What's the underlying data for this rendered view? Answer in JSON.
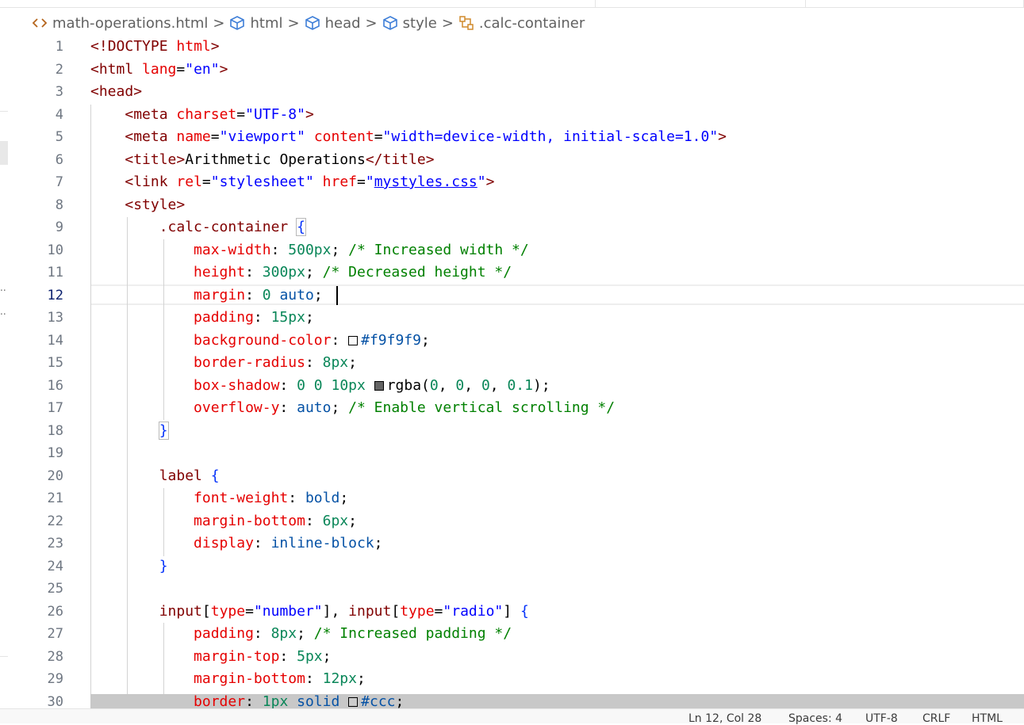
{
  "breadcrumb": [
    {
      "label": "math-operations.html",
      "icon": "html-file-icon"
    },
    {
      "label": "html",
      "icon": "cube-icon"
    },
    {
      "label": "head",
      "icon": "cube-icon"
    },
    {
      "label": "style",
      "icon": "cube-icon"
    },
    {
      "label": ".calc-container",
      "icon": "css-selector-icon"
    }
  ],
  "breadcrumb_separator": ">",
  "status_bar": {
    "position": "Ln 12, Col 28",
    "spaces": "Spaces: 4",
    "encoding": "UTF-8",
    "eol": "CRLF",
    "language": "HTML"
  },
  "edge_marks": [
    "..",
    ".."
  ],
  "editor": {
    "active_line": 12,
    "lines": [
      {
        "n": "1",
        "tokens": [
          [
            "t-punct",
            "<!"
          ],
          [
            "t-tag",
            "DOCTYPE"
          ],
          [
            "t-plain",
            " "
          ],
          [
            "t-attr",
            "html"
          ],
          [
            "t-punct",
            ">"
          ]
        ]
      },
      {
        "n": "2",
        "tokens": [
          [
            "t-punct",
            "<"
          ],
          [
            "t-tag",
            "html"
          ],
          [
            "t-plain",
            " "
          ],
          [
            "t-attr",
            "lang"
          ],
          [
            "t-plain",
            "="
          ],
          [
            "t-str",
            "\"en\""
          ],
          [
            "t-punct",
            ">"
          ]
        ]
      },
      {
        "n": "3",
        "tokens": [
          [
            "t-punct",
            "<"
          ],
          [
            "t-tag",
            "head"
          ],
          [
            "t-punct",
            ">"
          ]
        ]
      },
      {
        "n": "4",
        "tokens": [
          [
            "t-plain",
            "    "
          ],
          [
            "t-punct",
            "<"
          ],
          [
            "t-tag",
            "meta"
          ],
          [
            "t-plain",
            " "
          ],
          [
            "t-attr",
            "charset"
          ],
          [
            "t-plain",
            "="
          ],
          [
            "t-str",
            "\"UTF-8\""
          ],
          [
            "t-punct",
            ">"
          ]
        ]
      },
      {
        "n": "5",
        "tokens": [
          [
            "t-plain",
            "    "
          ],
          [
            "t-punct",
            "<"
          ],
          [
            "t-tag",
            "meta"
          ],
          [
            "t-plain",
            " "
          ],
          [
            "t-attr",
            "name"
          ],
          [
            "t-plain",
            "="
          ],
          [
            "t-str",
            "\"viewport\""
          ],
          [
            "t-plain",
            " "
          ],
          [
            "t-attr",
            "content"
          ],
          [
            "t-plain",
            "="
          ],
          [
            "t-str",
            "\"width=device-width, initial-scale=1.0\""
          ],
          [
            "t-punct",
            ">"
          ]
        ]
      },
      {
        "n": "6",
        "tokens": [
          [
            "t-plain",
            "    "
          ],
          [
            "t-punct",
            "<"
          ],
          [
            "t-tag",
            "title"
          ],
          [
            "t-punct",
            ">"
          ],
          [
            "t-text",
            "Arithmetic Operations"
          ],
          [
            "t-punct",
            "</"
          ],
          [
            "t-tag",
            "title"
          ],
          [
            "t-punct",
            ">"
          ]
        ]
      },
      {
        "n": "7",
        "tokens": [
          [
            "t-plain",
            "    "
          ],
          [
            "t-punct",
            "<"
          ],
          [
            "t-tag",
            "link"
          ],
          [
            "t-plain",
            " "
          ],
          [
            "t-attr",
            "rel"
          ],
          [
            "t-plain",
            "="
          ],
          [
            "t-str",
            "\"stylesheet\""
          ],
          [
            "t-plain",
            " "
          ],
          [
            "t-attr",
            "href"
          ],
          [
            "t-plain",
            "="
          ],
          [
            "t-str",
            "\""
          ],
          [
            "t-link",
            "mystyles.css"
          ],
          [
            "t-str",
            "\""
          ],
          [
            "t-punct",
            ">"
          ]
        ]
      },
      {
        "n": "8",
        "tokens": [
          [
            "t-plain",
            "    "
          ],
          [
            "t-punct",
            "<"
          ],
          [
            "t-tag",
            "style"
          ],
          [
            "t-punct",
            ">"
          ]
        ]
      },
      {
        "n": "9",
        "tokens": [
          [
            "t-plain",
            "        "
          ],
          [
            "t-sel",
            ".calc-container"
          ],
          [
            "t-plain",
            " "
          ],
          [
            "t-brace box",
            "{"
          ]
        ]
      },
      {
        "n": "10",
        "tokens": [
          [
            "t-plain",
            "            "
          ],
          [
            "t-prop",
            "max-width"
          ],
          [
            "t-plain",
            ": "
          ],
          [
            "t-num",
            "500px"
          ],
          [
            "t-plain",
            "; "
          ],
          [
            "t-com",
            "/* Increased width */"
          ]
        ]
      },
      {
        "n": "11",
        "tokens": [
          [
            "t-plain",
            "            "
          ],
          [
            "t-prop",
            "height"
          ],
          [
            "t-plain",
            ": "
          ],
          [
            "t-num",
            "300px"
          ],
          [
            "t-plain",
            "; "
          ],
          [
            "t-com",
            "/* Decreased height */"
          ]
        ]
      },
      {
        "n": "12",
        "tokens": [
          [
            "t-plain",
            "            "
          ],
          [
            "t-prop",
            "margin"
          ],
          [
            "t-plain",
            ": "
          ],
          [
            "t-num",
            "0"
          ],
          [
            "t-plain",
            " "
          ],
          [
            "t-kw",
            "auto"
          ],
          [
            "t-plain",
            ";"
          ]
        ]
      },
      {
        "n": "13",
        "tokens": [
          [
            "t-plain",
            "            "
          ],
          [
            "t-prop",
            "padding"
          ],
          [
            "t-plain",
            ": "
          ],
          [
            "t-num",
            "15px"
          ],
          [
            "t-plain",
            ";"
          ]
        ]
      },
      {
        "n": "14",
        "tokens": [
          [
            "t-plain",
            "            "
          ],
          [
            "t-prop",
            "background-color"
          ],
          [
            "t-plain",
            ": "
          ],
          [
            "swatch",
            "#f9f9f9"
          ],
          [
            "t-kw",
            "#f9f9f9"
          ],
          [
            "t-plain",
            ";"
          ]
        ]
      },
      {
        "n": "15",
        "tokens": [
          [
            "t-plain",
            "            "
          ],
          [
            "t-prop",
            "border-radius"
          ],
          [
            "t-plain",
            ": "
          ],
          [
            "t-num",
            "8px"
          ],
          [
            "t-plain",
            ";"
          ]
        ]
      },
      {
        "n": "16",
        "tokens": [
          [
            "t-plain",
            "            "
          ],
          [
            "t-prop",
            "box-shadow"
          ],
          [
            "t-plain",
            ": "
          ],
          [
            "t-num",
            "0"
          ],
          [
            "t-plain",
            " "
          ],
          [
            "t-num",
            "0"
          ],
          [
            "t-plain",
            " "
          ],
          [
            "t-num",
            "10px"
          ],
          [
            "t-plain",
            " "
          ],
          [
            "swatch",
            "#646464"
          ],
          [
            "t-plain",
            "rgba("
          ],
          [
            "t-num",
            "0"
          ],
          [
            "t-plain",
            ", "
          ],
          [
            "t-num",
            "0"
          ],
          [
            "t-plain",
            ", "
          ],
          [
            "t-num",
            "0"
          ],
          [
            "t-plain",
            ", "
          ],
          [
            "t-num",
            "0.1"
          ],
          [
            "t-plain",
            ");"
          ]
        ]
      },
      {
        "n": "17",
        "tokens": [
          [
            "t-plain",
            "            "
          ],
          [
            "t-prop",
            "overflow-y"
          ],
          [
            "t-plain",
            ": "
          ],
          [
            "t-kw",
            "auto"
          ],
          [
            "t-plain",
            "; "
          ],
          [
            "t-com",
            "/* Enable vertical scrolling */"
          ]
        ]
      },
      {
        "n": "18",
        "tokens": [
          [
            "t-plain",
            "        "
          ],
          [
            "t-brace box",
            "}"
          ]
        ]
      },
      {
        "n": "19",
        "tokens": []
      },
      {
        "n": "20",
        "tokens": [
          [
            "t-plain",
            "        "
          ],
          [
            "t-sel",
            "label"
          ],
          [
            "t-plain",
            " "
          ],
          [
            "t-brace",
            "{"
          ]
        ]
      },
      {
        "n": "21",
        "tokens": [
          [
            "t-plain",
            "            "
          ],
          [
            "t-prop",
            "font-weight"
          ],
          [
            "t-plain",
            ": "
          ],
          [
            "t-kw",
            "bold"
          ],
          [
            "t-plain",
            ";"
          ]
        ]
      },
      {
        "n": "22",
        "tokens": [
          [
            "t-plain",
            "            "
          ],
          [
            "t-prop",
            "margin-bottom"
          ],
          [
            "t-plain",
            ": "
          ],
          [
            "t-num",
            "6px"
          ],
          [
            "t-plain",
            ";"
          ]
        ]
      },
      {
        "n": "23",
        "tokens": [
          [
            "t-plain",
            "            "
          ],
          [
            "t-prop",
            "display"
          ],
          [
            "t-plain",
            ": "
          ],
          [
            "t-kw",
            "inline-block"
          ],
          [
            "t-plain",
            ";"
          ]
        ]
      },
      {
        "n": "24",
        "tokens": [
          [
            "t-plain",
            "        "
          ],
          [
            "t-brace",
            "}"
          ]
        ]
      },
      {
        "n": "25",
        "tokens": []
      },
      {
        "n": "26",
        "tokens": [
          [
            "t-plain",
            "        "
          ],
          [
            "t-sel",
            "input"
          ],
          [
            "t-plain",
            "["
          ],
          [
            "t-attr",
            "type"
          ],
          [
            "t-plain",
            "="
          ],
          [
            "t-str",
            "\"number\""
          ],
          [
            "t-plain",
            "], "
          ],
          [
            "t-sel",
            "input"
          ],
          [
            "t-plain",
            "["
          ],
          [
            "t-attr",
            "type"
          ],
          [
            "t-plain",
            "="
          ],
          [
            "t-str",
            "\"radio\""
          ],
          [
            "t-plain",
            "] "
          ],
          [
            "t-brace",
            "{"
          ]
        ]
      },
      {
        "n": "27",
        "tokens": [
          [
            "t-plain",
            "            "
          ],
          [
            "t-prop",
            "padding"
          ],
          [
            "t-plain",
            ": "
          ],
          [
            "t-num",
            "8px"
          ],
          [
            "t-plain",
            "; "
          ],
          [
            "t-com",
            "/* Increased padding */"
          ]
        ]
      },
      {
        "n": "28",
        "tokens": [
          [
            "t-plain",
            "            "
          ],
          [
            "t-prop",
            "margin-top"
          ],
          [
            "t-plain",
            ": "
          ],
          [
            "t-num",
            "5px"
          ],
          [
            "t-plain",
            ";"
          ]
        ]
      },
      {
        "n": "29",
        "tokens": [
          [
            "t-plain",
            "            "
          ],
          [
            "t-prop",
            "margin-bottom"
          ],
          [
            "t-plain",
            ": "
          ],
          [
            "t-num",
            "12px"
          ],
          [
            "t-plain",
            ";"
          ]
        ]
      },
      {
        "n": "30",
        "tokens": [
          [
            "t-plain",
            "            "
          ],
          [
            "t-prop",
            "border"
          ],
          [
            "t-plain",
            ": "
          ],
          [
            "t-num",
            "1px"
          ],
          [
            "t-plain",
            " "
          ],
          [
            "t-kw",
            "solid"
          ],
          [
            "t-plain",
            " "
          ],
          [
            "swatch",
            "#cccccc"
          ],
          [
            "t-kw",
            "#ccc"
          ],
          [
            "t-plain",
            ";"
          ]
        ]
      }
    ]
  }
}
